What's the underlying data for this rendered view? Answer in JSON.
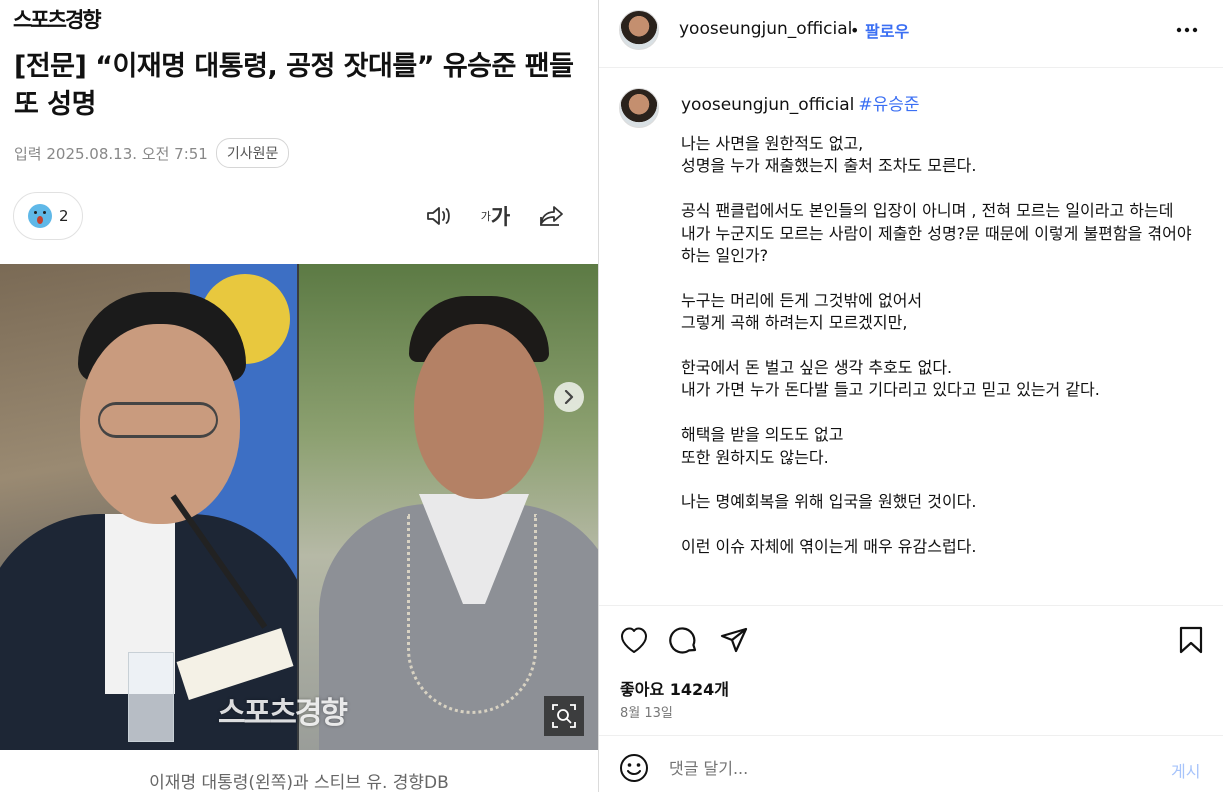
{
  "article": {
    "logo": "스포츠경향",
    "headline": "[전문] “이재명 대통령, 공정 잣대를” 유승준 팬들 또 성명",
    "date": "입력 2025.08.13. 오전 7:51",
    "source_button": "기사원문",
    "reaction_count": "2",
    "font_size_small": "가",
    "font_size_large": "가",
    "watermark": "스포츠경향",
    "caption": "이재명 대통령(왼쪽)과 스티브 유. 경향DB"
  },
  "post": {
    "username": "yooseungjun_official",
    "separator": "•",
    "follow_label": "팔로우",
    "caption_username": "yooseungjun_official",
    "hashtag": "#유승준",
    "paragraphs": [
      "나는 사면을 원한적도 없고,\n성명을 누가 재출했는지 출처 조차도 모른다.",
      "공식 팬클럽에서도 본인들의 입장이 아니며 , 전혀 모르는 일이라고 하는데\n내가 누군지도 모르는 사람이 제출한 성명?문 때문에 이렇게 불편함을 겪어야 하는 일인가?",
      "누구는 머리에 든게 그것밖에 없어서\n그렇게 곡해 하려는지 모르겠지만,",
      "한국에서 돈 벌고 싶은 생각 추호도 없다.\n내가 가면 누가 돈다발 들고 기다리고 있다고 믿고 있는거 같다.",
      "해택을 받을 의도도 없고\n또한 원하지도 않는다.",
      "나는 명예회복을 위해 입국을 원했던 것이다.",
      "이런 이슈 자체에 엮이는게 매우 유감스럽다."
    ],
    "likes": "좋아요 1424개",
    "date": "8월 13일",
    "comment_placeholder": "댓글 달기...",
    "post_button": "게시"
  },
  "colors": {
    "link_blue": "#3b6ff3",
    "post_button_disabled": "#a7c4fb"
  }
}
